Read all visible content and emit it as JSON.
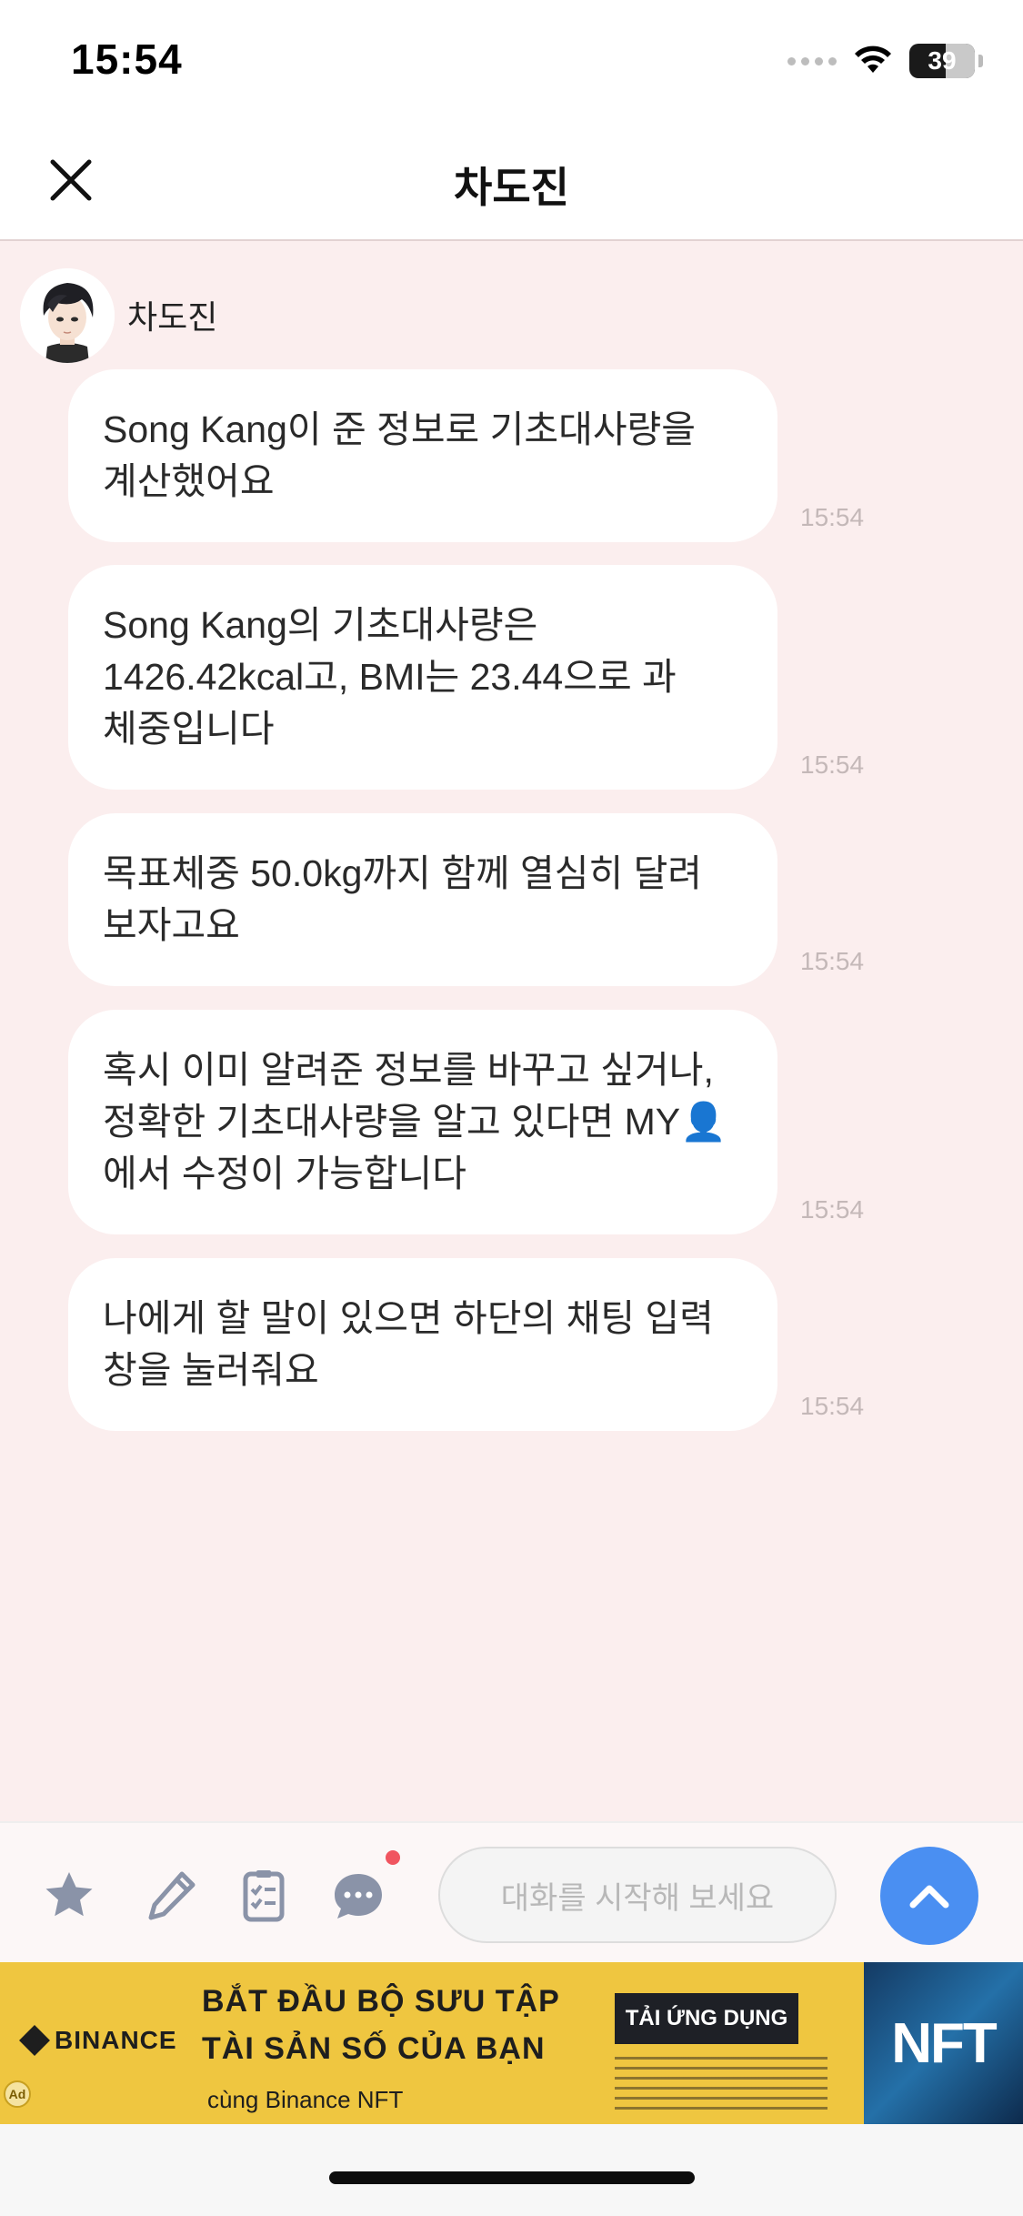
{
  "status_bar": {
    "time": "15:54",
    "battery": "39"
  },
  "header": {
    "title": "차도진"
  },
  "chat": {
    "sender_name": "차도진",
    "messages": [
      {
        "lines": [
          "Song Kang이 준 정보로 기초대사량을",
          "계산했어요"
        ],
        "time": "15:54"
      },
      {
        "lines": [
          "Song Kang의 기초대사량은",
          "1426.42kcal고, BMI는 23.44으로 과",
          "체중입니다"
        ],
        "time": "15:54"
      },
      {
        "lines": [
          "목표체중 50.0kg까지 함께 열심히 달려",
          "보자고요"
        ],
        "time": "15:54"
      },
      {
        "lines": [
          "혹시 이미 알려준 정보를 바꾸고 싶거나,",
          "정확한 기초대사량을 알고 있다면 MY👤",
          "에서 수정이 가능합니다"
        ],
        "time": "15:54"
      },
      {
        "lines": [
          "나에게 할 말이 있으면 하단의 채팅 입력",
          "창을 눌러줘요"
        ],
        "time": "15:54"
      }
    ]
  },
  "input_bar": {
    "placeholder": "대화를 시작해 보세요"
  },
  "icons": {
    "close": "close-icon",
    "tools": [
      "star-icon",
      "pencil-icon",
      "checklist-icon",
      "chat-bubble-icon"
    ],
    "send": "chevron-up-icon"
  },
  "ad": {
    "brand": "BINANCE",
    "headline_1": "BẮT ĐẦU BỘ SƯU TẬP",
    "headline_2": "TÀI SẢN SỐ CỦA BẠN",
    "subline": "cùng Binance NFT",
    "cta": "TẢI ỨNG DỤNG",
    "image_text": "NFT",
    "badge": "Ad"
  },
  "colors": {
    "chat_background": "#fbeeee",
    "bubble": "#ffffff",
    "accent_blue": "#4a8ff2",
    "icon_gray": "#8a93a8",
    "notify_red": "#f05560",
    "ad_yellow": "#efc640"
  }
}
